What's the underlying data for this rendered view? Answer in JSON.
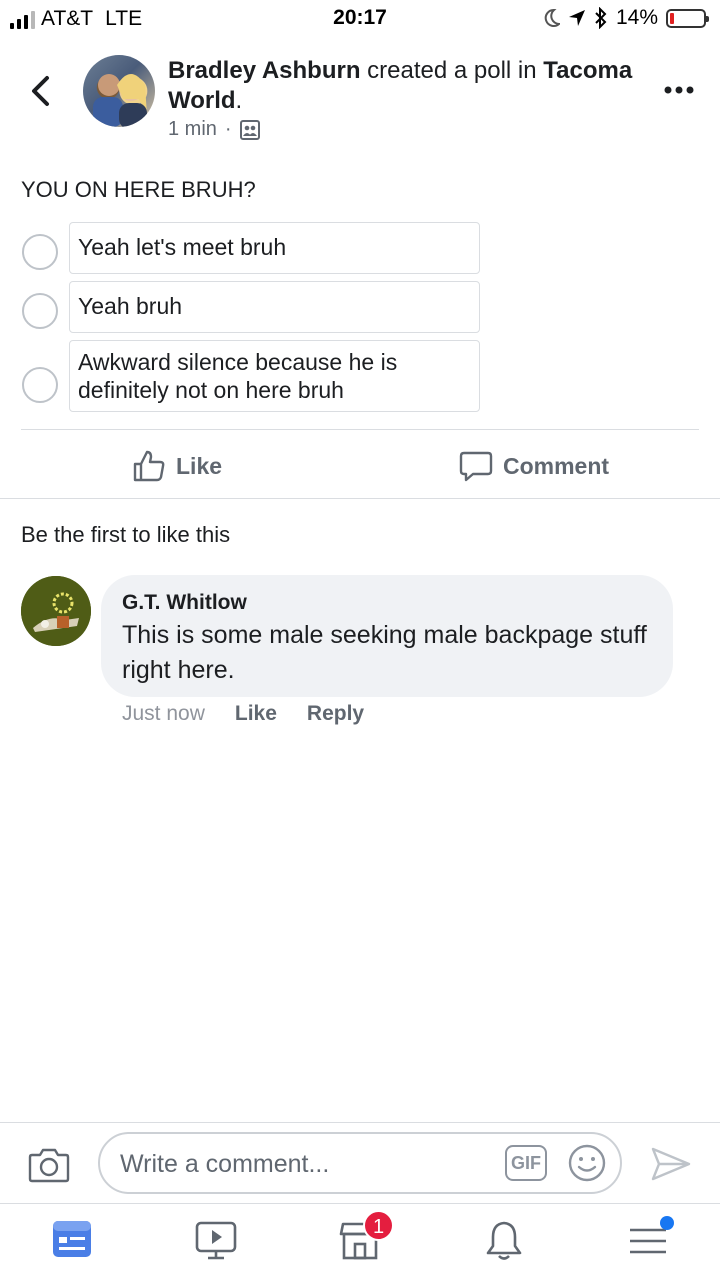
{
  "status_bar": {
    "carrier": "AT&T",
    "network": "LTE",
    "time": "20:17",
    "battery": "14%",
    "battery_level": 0.14
  },
  "post": {
    "author": "Bradley Ashburn",
    "action_text": "created a poll in",
    "group": "Tacoma World",
    "period": ".",
    "time": "1 min",
    "separator": "·",
    "audience_icon": "group-audience-icon"
  },
  "poll": {
    "question": "YOU ON HERE BRUH?",
    "options": [
      "Yeah let's meet bruh",
      "Yeah bruh",
      "Awkward silence because he is definitely not on here bruh"
    ]
  },
  "actions": {
    "like": "Like",
    "comment": "Comment"
  },
  "likes_text": "Be the first to like this",
  "comment": {
    "author": "G.T. Whitlow",
    "text": "This is some male seeking male backpage stuff right here.",
    "time": "Just now",
    "like": "Like",
    "reply": "Reply"
  },
  "composer": {
    "placeholder": "Write a comment...",
    "gif_label": "GIF"
  },
  "bottom_nav": {
    "marketplace_badge": "1"
  },
  "colors": {
    "accent": "#1877f2",
    "badge": "#e41e3f",
    "secondary_text": "#606770"
  }
}
